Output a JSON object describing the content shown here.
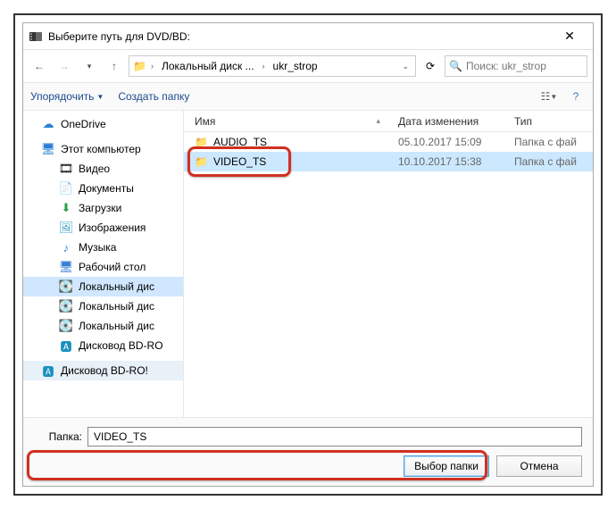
{
  "title": "Выберите путь для DVD/BD:",
  "breadcrumb": {
    "crumb1": "Локальный диск ...",
    "crumb2": "ukr_strop"
  },
  "search": {
    "placeholder": "Поиск: ukr_strop"
  },
  "toolbar": {
    "organize": "Упорядочить",
    "newfolder": "Создать папку"
  },
  "columns": {
    "name": "Имя",
    "date": "Дата изменения",
    "type": "Тип"
  },
  "rows": [
    {
      "name": "AUDIO_TS",
      "date": "05.10.2017 15:09",
      "type": "Папка с фай"
    },
    {
      "name": "VIDEO_TS",
      "date": "10.10.2017 15:38",
      "type": "Папка с фай"
    }
  ],
  "sidebar": {
    "onedrive": "OneDrive",
    "thispc": "Этот компьютер",
    "video": "Видео",
    "docs": "Документы",
    "downloads": "Загрузки",
    "pictures": "Изображения",
    "music": "Музыка",
    "desktop": "Рабочий стол",
    "localdisk": "Локальный дис",
    "localdisk2": "Локальный дис",
    "localdisk3": "Локальный дис",
    "bd1": "Дисковод BD-RO",
    "bd2": "Дисковод BD-RO!"
  },
  "footer": {
    "folderlabel": "Папка:",
    "foldername": "VIDEO_TS",
    "select": "Выбор папки",
    "cancel": "Отмена"
  }
}
